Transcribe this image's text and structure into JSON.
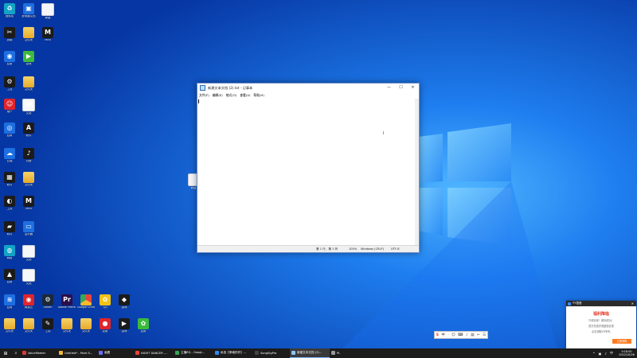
{
  "desktop": {
    "icons": [
      {
        "label": "回收站",
        "icon": "recycle-bin-icon",
        "glyph": "♻",
        "style": "g-teal"
      },
      {
        "label": "此电脑文档",
        "icon": "pc-icon",
        "glyph": "▣",
        "style": "g-blue"
      },
      {
        "label": "新建",
        "icon": "document-icon",
        "glyph": "",
        "style": "g-doc"
      },
      {
        "label": "剪映",
        "icon": "capcut-icon",
        "glyph": "✂",
        "style": "g-dark"
      },
      {
        "label": "文件夹",
        "icon": "folder-icon",
        "glyph": "",
        "style": "g-folder"
      },
      {
        "label": "MINI",
        "icon": "mini-app-icon",
        "glyph": "M",
        "style": "g-dark"
      },
      {
        "label": "应用",
        "icon": "app-icon",
        "glyph": "◉",
        "style": "g-blue"
      },
      {
        "label": "游戏",
        "icon": "game-icon",
        "glyph": "▶",
        "style": "g-green"
      },
      {
        "label": "工具",
        "icon": "tool-icon",
        "glyph": "⚙",
        "style": "g-dark"
      },
      {
        "label": "文件夹",
        "icon": "folder-icon",
        "glyph": "",
        "style": "g-folder"
      },
      {
        "label": "用户",
        "icon": "user-app-icon",
        "glyph": "☺",
        "style": "g-red"
      },
      {
        "label": "文档",
        "icon": "word-doc-icon",
        "glyph": "W",
        "style": "g-doc"
      },
      {
        "label": "应用",
        "icon": "app-icon",
        "glyph": "◎",
        "style": "g-blue"
      },
      {
        "label": "软件",
        "icon": "app-icon",
        "glyph": "A",
        "style": "g-dark"
      },
      {
        "label": "云端",
        "icon": "cloud-icon",
        "glyph": "☁",
        "style": "g-blue"
      },
      {
        "label": "抖音",
        "icon": "tiktok-icon",
        "glyph": "♪",
        "style": "g-dark"
      },
      {
        "label": "软件",
        "icon": "app-icon",
        "glyph": "▦",
        "style": "g-dark"
      },
      {
        "label": "文件夹",
        "icon": "folder-icon",
        "glyph": "",
        "style": "g-folder"
      },
      {
        "label": "工具",
        "icon": "app-icon",
        "glyph": "◐",
        "style": "g-dark"
      },
      {
        "label": "MINI",
        "icon": "mini-app-icon",
        "glyph": "M",
        "style": "g-dark"
      },
      {
        "label": "软件",
        "icon": "nvidia-icon",
        "glyph": "▰",
        "style": "g-dark"
      },
      {
        "label": "显示器",
        "icon": "monitor-icon",
        "glyph": "▭",
        "style": "g-blue"
      },
      {
        "label": "网络",
        "icon": "network-icon",
        "glyph": "◍",
        "style": "g-teal"
      },
      {
        "label": "文档",
        "icon": "document-icon",
        "glyph": "",
        "style": "g-doc"
      },
      {
        "label": "应用",
        "icon": "app-icon",
        "glyph": "▲",
        "style": "g-dark"
      },
      {
        "label": "文档",
        "icon": "document-icon",
        "glyph": "",
        "style": "g-doc"
      },
      {
        "label": "应用",
        "icon": "app-icon",
        "glyph": "≋",
        "style": "g-blue"
      },
      {
        "label": "网易云",
        "icon": "netease-music-icon",
        "glyph": "◉",
        "style": "g-red"
      },
      {
        "label": "Steam",
        "icon": "steam-icon",
        "glyph": "⚙",
        "style": "g-steam"
      },
      {
        "label": "Adobe Premiere",
        "icon": "premiere-icon",
        "glyph": "Pr",
        "style": "g-purple"
      },
      {
        "label": "Google Chrome",
        "icon": "chrome-icon",
        "glyph": "",
        "style": "g-chrome"
      },
      {
        "label": "QQ",
        "icon": "qq-icon",
        "glyph": "✿",
        "style": "g-yellow"
      },
      {
        "label": "游戏",
        "icon": "game-icon",
        "glyph": "◆",
        "style": "g-dark"
      },
      {
        "label": "文件夹",
        "icon": "folder-icon",
        "glyph": "",
        "style": "g-folder"
      },
      {
        "label": "文件夹",
        "icon": "folder-icon",
        "glyph": "",
        "style": "g-folder"
      },
      {
        "label": "工具",
        "icon": "tool-icon",
        "glyph": "✎",
        "style": "g-dark"
      },
      {
        "label": "文件夹",
        "icon": "folder-icon",
        "glyph": "",
        "style": "g-folder"
      },
      {
        "label": "文件夹",
        "icon": "folder-icon",
        "glyph": "",
        "style": "g-folder"
      },
      {
        "label": "应用",
        "icon": "app-icon",
        "glyph": "●",
        "style": "g-red"
      },
      {
        "label": "游戏",
        "icon": "game-icon",
        "glyph": "▶",
        "style": "g-dark"
      },
      {
        "label": "应用",
        "icon": "app-icon",
        "glyph": "✿",
        "style": "g-green"
      }
    ],
    "stray_doc_label": "新建"
  },
  "notepad": {
    "title": "新建文本文档 (2).txt - 记事本",
    "menu": [
      "文件(F)",
      "编辑(E)",
      "格式(O)",
      "查看(V)",
      "帮助(H)"
    ],
    "minimize": "—",
    "maximize": "☐",
    "close": "✕",
    "content": "",
    "status": {
      "position": "第 1 行，第 1 列",
      "zoom": "100%",
      "line_ending": "Windows (CRLF)",
      "encoding": "UTF-8"
    }
  },
  "toast": {
    "app": "YY语音",
    "close": "✕",
    "title": "福利降临",
    "lines": [
      "只收玩家！助你成功！",
      "首次充值享受超值优惠",
      "点击领取VIP好礼"
    ],
    "button": "立即领取"
  },
  "ime": {
    "logo": "S",
    "items": [
      "中",
      "·",
      "☺",
      "⌨",
      "♪",
      "▤",
      "✂",
      "☰"
    ]
  },
  "taskbar": {
    "start": "⊞",
    "search": "⌕",
    "items": [
      {
        "label": "VoiceMeeter",
        "color": "#d93a3a",
        "active": false,
        "width": 46
      },
      {
        "label": "Untitled* - Paint S...",
        "color": "#f0b93a",
        "active": false,
        "width": 50
      },
      {
        "label": "画图",
        "color": "#6c6cff",
        "active": false,
        "width": 46
      },
      {
        "label": "NIGHT DANCER -...",
        "color": "#e8453c",
        "active": false,
        "width": 50
      },
      {
        "label": "主播RQ - Googl...",
        "color": "#3aa757",
        "active": false,
        "width": 50
      },
      {
        "label": "私信【荣格的作】...",
        "color": "#2d8cf0",
        "active": false,
        "width": 50
      },
      {
        "label": "SongSigPro",
        "color": "#444",
        "active": false,
        "width": 46
      },
      {
        "label": "新建文本文档 (2)...",
        "color": "#8fc4ff",
        "active": true,
        "width": 50
      },
      {
        "label": "PL",
        "color": "#999",
        "active": false,
        "width": 26
      }
    ],
    "tray": {
      "icons": [
        "^",
        "▣",
        "♪",
        "中"
      ],
      "time": "9:18:00",
      "date": "2022/10/26"
    }
  },
  "colors": {
    "wallpaper_dark": "#0a3fa8",
    "wallpaper_light": "#1e8fff",
    "accent": "#7fb3ff"
  }
}
